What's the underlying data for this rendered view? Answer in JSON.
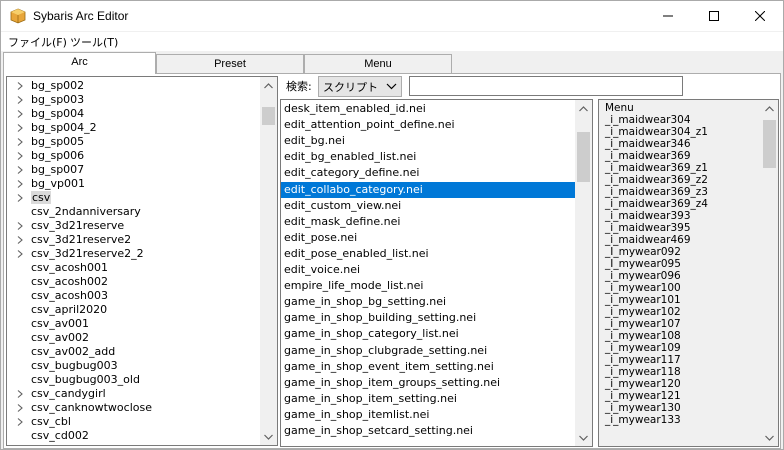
{
  "window": {
    "title": "Sybaris Arc Editor"
  },
  "menubar": {
    "file": "ファイル(F)",
    "tool": "ツール(T)"
  },
  "tabs": [
    {
      "label": "Arc",
      "active": true
    },
    {
      "label": "Preset",
      "active": false
    },
    {
      "label": "Menu",
      "active": false
    }
  ],
  "tree": {
    "items": [
      {
        "label": "bg_sp002",
        "expandable": true
      },
      {
        "label": "bg_sp003",
        "expandable": true
      },
      {
        "label": "bg_sp004",
        "expandable": true
      },
      {
        "label": "bg_sp004_2",
        "expandable": true
      },
      {
        "label": "bg_sp005",
        "expandable": true
      },
      {
        "label": "bg_sp006",
        "expandable": true
      },
      {
        "label": "bg_sp007",
        "expandable": true
      },
      {
        "label": "bg_vp001",
        "expandable": true
      },
      {
        "label": "csv",
        "expandable": true,
        "selected": true
      },
      {
        "label": "csv_2ndanniversary",
        "expandable": false
      },
      {
        "label": "csv_3d21reserve",
        "expandable": true
      },
      {
        "label": "csv_3d21reserve2",
        "expandable": true
      },
      {
        "label": "csv_3d21reserve2_2",
        "expandable": true
      },
      {
        "label": "csv_acosh001",
        "expandable": false
      },
      {
        "label": "csv_acosh002",
        "expandable": false
      },
      {
        "label": "csv_acosh003",
        "expandable": false
      },
      {
        "label": "csv_april2020",
        "expandable": false
      },
      {
        "label": "csv_av001",
        "expandable": false
      },
      {
        "label": "csv_av002",
        "expandable": false
      },
      {
        "label": "csv_av002_add",
        "expandable": false
      },
      {
        "label": "csv_bugbug003",
        "expandable": false
      },
      {
        "label": "csv_bugbug003_old",
        "expandable": false
      },
      {
        "label": "csv_candygirl",
        "expandable": true
      },
      {
        "label": "csv_canknowtwoclose",
        "expandable": true
      },
      {
        "label": "csv_cbl",
        "expandable": true
      },
      {
        "label": "csv_cd002",
        "expandable": false
      }
    ]
  },
  "search": {
    "label": "検索:",
    "mode": "スクリプト",
    "value": ""
  },
  "files": {
    "items": [
      {
        "label": "desk_item_enabled_id.nei"
      },
      {
        "label": "edit_attention_point_define.nei"
      },
      {
        "label": "edit_bg.nei"
      },
      {
        "label": "edit_bg_enabled_list.nei"
      },
      {
        "label": "edit_category_define.nei"
      },
      {
        "label": "edit_collabo_category.nei",
        "selected": true
      },
      {
        "label": "edit_custom_view.nei"
      },
      {
        "label": "edit_mask_define.nei"
      },
      {
        "label": "edit_pose.nei"
      },
      {
        "label": "edit_pose_enabled_list.nei"
      },
      {
        "label": "edit_voice.nei"
      },
      {
        "label": "empire_life_mode_list.nei"
      },
      {
        "label": "game_in_shop_bg_setting.nei"
      },
      {
        "label": "game_in_shop_building_setting.nei"
      },
      {
        "label": "game_in_shop_category_list.nei"
      },
      {
        "label": "game_in_shop_clubgrade_setting.nei"
      },
      {
        "label": "game_in_shop_event_item_setting.nei"
      },
      {
        "label": "game_in_shop_item_groups_setting.nei"
      },
      {
        "label": "game_in_shop_item_setting.nei"
      },
      {
        "label": "game_in_shop_itemlist.nei"
      },
      {
        "label": "game_in_shop_setcard_setting.nei"
      }
    ]
  },
  "menu_panel": {
    "items": [
      {
        "label": "Menu"
      },
      {
        "label": "_i_maidwear304"
      },
      {
        "label": "_i_maidwear304_z1"
      },
      {
        "label": "_i_maidwear346"
      },
      {
        "label": "_i_maidwear369"
      },
      {
        "label": "_i_maidwear369_z1"
      },
      {
        "label": "_i_maidwear369_z2"
      },
      {
        "label": "_i_maidwear369_z3"
      },
      {
        "label": "_i_maidwear369_z4"
      },
      {
        "label": "_i_maidwear393"
      },
      {
        "label": "_i_maidwear395"
      },
      {
        "label": "_i_maidwear469"
      },
      {
        "label": "_I_mywear092"
      },
      {
        "label": "_I_mywear095"
      },
      {
        "label": "_i_mywear096"
      },
      {
        "label": "_i_mywear100"
      },
      {
        "label": "_i_mywear101"
      },
      {
        "label": "_i_mywear102"
      },
      {
        "label": "_i_mywear107"
      },
      {
        "label": "_i_mywear108"
      },
      {
        "label": "_i_mywear109"
      },
      {
        "label": "_i_mywear117"
      },
      {
        "label": "_i_mywear118"
      },
      {
        "label": "_i_mywear120"
      },
      {
        "label": "_i_mywear121"
      },
      {
        "label": "_i_mywear130"
      },
      {
        "label": "_i_mywear133"
      }
    ]
  },
  "colors": {
    "selection": "#0078d7",
    "tree_selection": "#dadada",
    "scroll_thumb": "#cdcdcd"
  }
}
